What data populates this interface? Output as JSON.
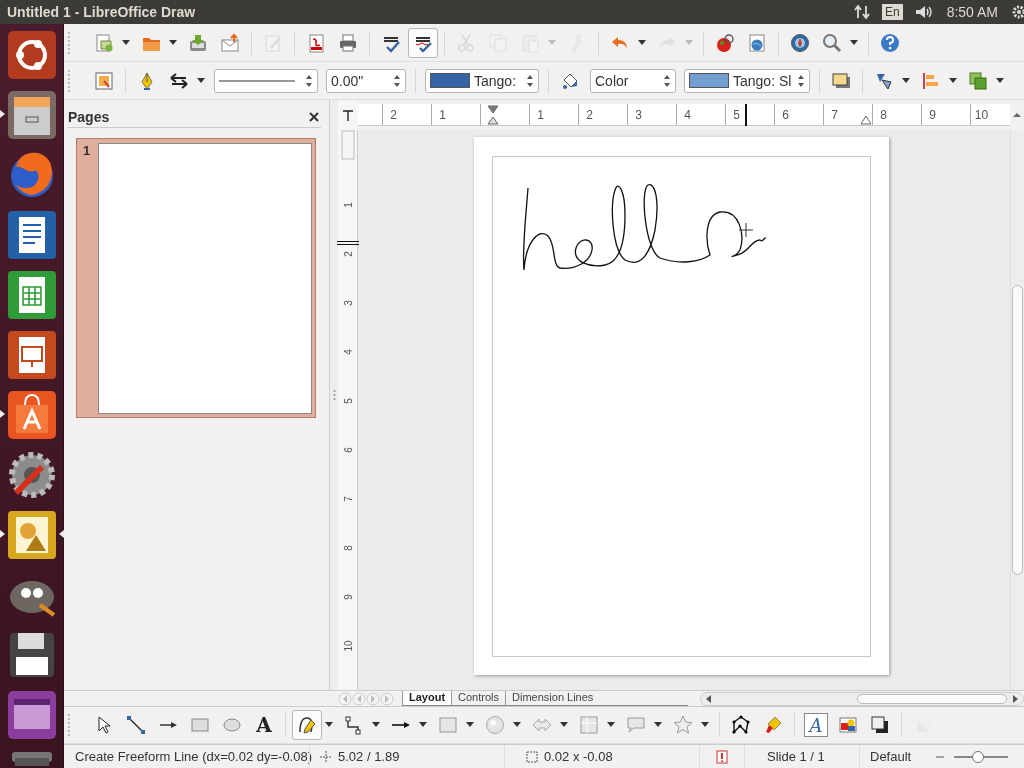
{
  "window": {
    "title": "Untitled 1 - LibreOffice Draw"
  },
  "top_panel": {
    "keyboard_layout": "En",
    "clock": "8:50 AM"
  },
  "launcher": {
    "items": [
      {
        "running": false,
        "focused": false
      },
      {
        "running": true,
        "focused": false
      },
      {
        "running": false,
        "focused": false
      },
      {
        "running": false,
        "focused": false
      },
      {
        "running": false,
        "focused": false
      },
      {
        "running": false,
        "focused": false
      },
      {
        "running": true,
        "focused": false
      },
      {
        "running": false,
        "focused": false
      },
      {
        "running": true,
        "focused": true
      },
      {
        "running": false,
        "focused": false
      },
      {
        "running": false,
        "focused": false
      },
      {
        "running": false,
        "focused": false
      },
      {
        "running": false,
        "focused": false
      }
    ]
  },
  "standard_toolbar": {
    "auto_spellcheck_on": true,
    "edit_actions_disabled": true
  },
  "line_and_filling_toolbar": {
    "line_width": "0.00\"",
    "line_color": {
      "label": "Tango:",
      "color": "#3465a4"
    },
    "area_style": "Color",
    "area_color": {
      "label": "Tango: Sl",
      "color": "#729fcf"
    }
  },
  "pages_panel": {
    "title": "Pages",
    "pages": [
      {
        "number": "1",
        "selected": true
      }
    ]
  },
  "horizontal_ruler": {
    "left_labels": [
      "2",
      "1"
    ],
    "right_labels": [
      "1",
      "2",
      "3",
      "4",
      "5",
      "6",
      "7",
      "8",
      "9",
      "10"
    ]
  },
  "vertical_ruler": {
    "labels": [
      "1",
      "2",
      "3",
      "4",
      "5",
      "6",
      "7",
      "8",
      "9",
      "10"
    ]
  },
  "layer_tabs": [
    {
      "label": "Layout",
      "selected": true
    },
    {
      "label": "Controls",
      "selected": false
    },
    {
      "label": "Dimension Lines",
      "selected": false
    }
  ],
  "drawing_toolbar": {
    "curve_tool_selected": true,
    "text_tool_glyph": "A",
    "fontwork_glyph": "A"
  },
  "status_bar": {
    "message": "Create Freeform Line (dx=0.02 dy=-0.08)",
    "position": "5.02 / 1.89",
    "size": "0.02 x -0.08",
    "slide": "Slide 1 / 1",
    "page_style": "Default",
    "zoom": {
      "level": 0.45
    }
  }
}
